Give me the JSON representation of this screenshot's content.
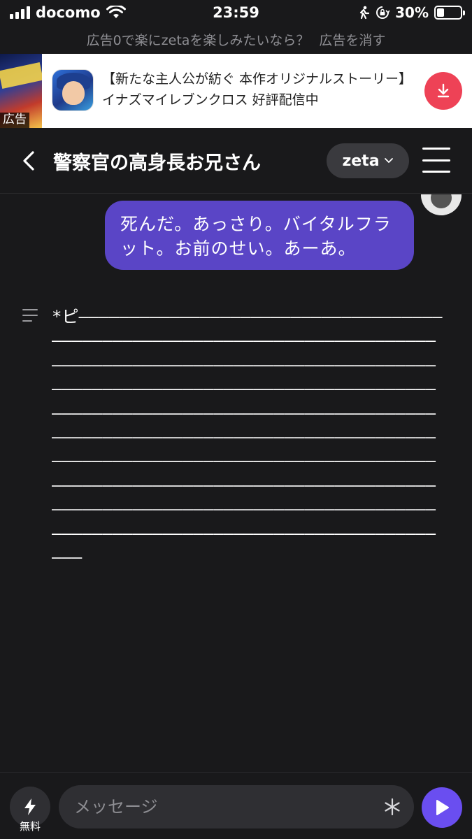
{
  "status_bar": {
    "carrier": "docomo",
    "time": "23:59",
    "battery_percent": "30%",
    "battery_level": 0.3
  },
  "ad_remove": {
    "promo_text": "広告0で楽にzetaを楽しみたいなら？",
    "remove_link": "広告を消す"
  },
  "ad_banner": {
    "tag": "広告",
    "text": "【新たな主人公が紡ぐ 本作オリジナルストーリー】イナズマイレブンクロス 好評配信中"
  },
  "header": {
    "title": "警察官の高身長お兄さん",
    "model_label": "zeta"
  },
  "chat": {
    "user_message": "死んだ。あっさり。バイタルフラット。お前のせい。あーあ。",
    "bot_message": "*ピ―――――――――――――――――――――――――――――――――――――――――――――――――――――――――――――――――――――――――――――――――――――――――――――――――――――――――――――――――――――――――――――――――――――――――――――――――――――――――――――――――――――――――――――――――――――――――――――――――――――――――――――――――――――――――――――――――――――――――――――――――――――――――――――――――――――――――――――――――――――――――――――――――――――――――――――――――――――――――――――――――――――――――――――――――――――――――――――――――――――――――――――――――――――――――――――"
  },
  "input": {
    "placeholder": "メッセージ",
    "boost_label": "無料"
  },
  "colors": {
    "background": "#19191b",
    "user_bubble": "#5a45c6",
    "send_button": "#6a4ef0",
    "download_button": "#ee4256"
  }
}
